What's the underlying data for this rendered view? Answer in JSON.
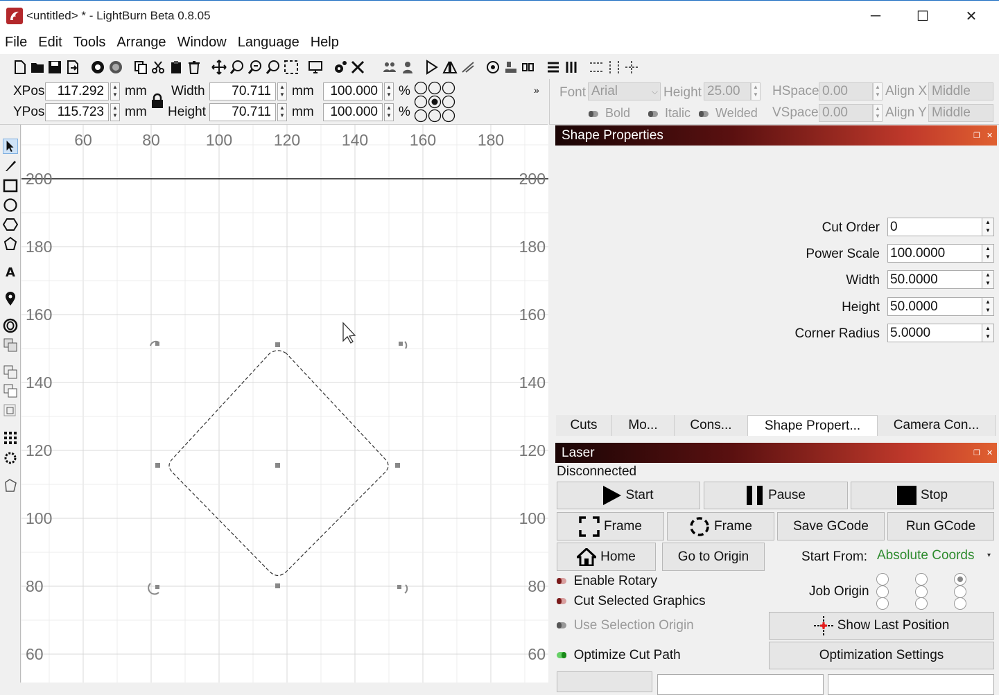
{
  "window": {
    "title": "<untitled> * - LightBurn Beta 0.8.05",
    "minimize": "─",
    "maximize": "☐",
    "close": "✕"
  },
  "menu": [
    "File",
    "Edit",
    "Tools",
    "Arrange",
    "Window",
    "Language",
    "Help"
  ],
  "position": {
    "xpos_label": "XPos",
    "xpos_value": "117.292",
    "ypos_label": "YPos",
    "ypos_value": "115.723",
    "unit": "mm",
    "width_label": "Width",
    "width_value": "70.711",
    "height_label": "Height",
    "height_value": "70.711",
    "width_pct": "100.000",
    "height_pct": "100.000",
    "pct": "%",
    "overflow": "»"
  },
  "text_props": {
    "font_label": "Font",
    "font_value": "Arial",
    "height_label": "Height",
    "height_value": "25.00",
    "hspace_label": "HSpace",
    "hspace_value": "0.00",
    "vspace_label": "VSpace",
    "vspace_value": "0.00",
    "alignx_label": "Align X",
    "alignx_value": "Middle",
    "aligny_label": "Align Y",
    "aligny_value": "Middle",
    "bold": "Bold",
    "italic": "Italic",
    "welded": "Welded"
  },
  "ruler": {
    "x_ticks": [
      "60",
      "80",
      "100",
      "120",
      "140",
      "160",
      "180"
    ],
    "y_ticks": [
      "200",
      "180",
      "160",
      "140",
      "120",
      "100",
      "80",
      "60"
    ]
  },
  "shape_properties": {
    "title": "Shape Properties",
    "cut_order_label": "Cut Order",
    "cut_order": "0",
    "power_scale_label": "Power Scale",
    "power_scale": "100.0000",
    "width_label": "Width",
    "width": "50.0000",
    "height_label": "Height",
    "height": "50.0000",
    "corner_radius_label": "Corner Radius",
    "corner_radius": "5.0000"
  },
  "tabs": [
    "Cuts",
    "Mo...",
    "Cons...",
    "Shape Propert...",
    "Camera Con..."
  ],
  "laser": {
    "title": "Laser",
    "status": "Disconnected",
    "start": "Start",
    "pause": "Pause",
    "stop": "Stop",
    "frame1": "Frame",
    "frame2": "Frame",
    "save_gcode": "Save GCode",
    "run_gcode": "Run GCode",
    "home": "Home",
    "go_to_origin": "Go to Origin",
    "start_from_label": "Start From:",
    "start_from_value": "Absolute Coords",
    "enable_rotary": "Enable Rotary",
    "cut_selected": "Cut Selected Graphics",
    "use_selection_origin": "Use Selection Origin",
    "optimize_cut_path": "Optimize Cut Path",
    "job_origin_label": "Job Origin",
    "show_last_position": "Show Last Position",
    "optimization_settings": "Optimization Settings"
  },
  "colors": {
    "accent_red": "#c0392b",
    "selection": "#333333"
  }
}
